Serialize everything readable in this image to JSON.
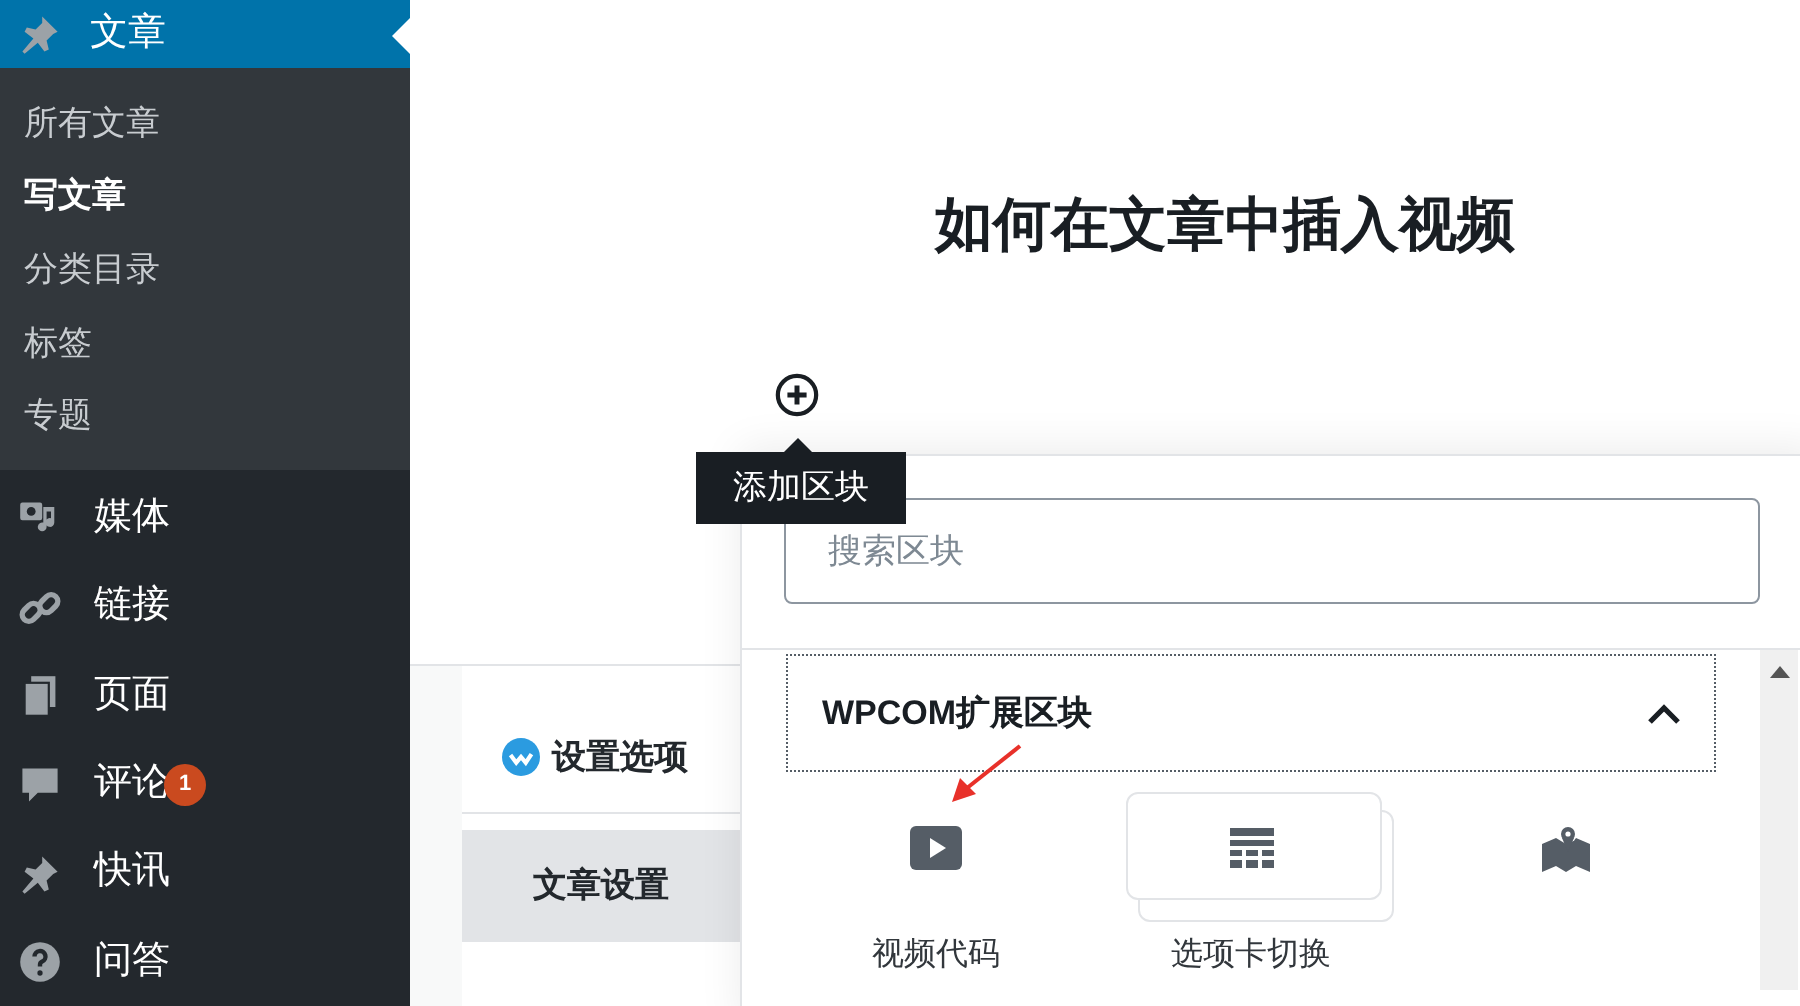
{
  "sidebar": {
    "current": {
      "label": "文章",
      "expanded": true
    },
    "submenu": [
      {
        "label": "所有文章",
        "selected": false
      },
      {
        "label": "写文章",
        "selected": true
      },
      {
        "label": "分类目录",
        "selected": false
      },
      {
        "label": "标签",
        "selected": false
      },
      {
        "label": "专题",
        "selected": false
      }
    ],
    "items": [
      {
        "kind": "media",
        "label": "媒体"
      },
      {
        "kind": "link",
        "label": "链接"
      },
      {
        "kind": "page",
        "label": "页面"
      },
      {
        "kind": "comment",
        "label": "评论",
        "badge": "1"
      },
      {
        "kind": "pin",
        "label": "快讯"
      },
      {
        "kind": "help",
        "label": "问答"
      }
    ]
  },
  "post_title": "如何在文章中插入视频",
  "add_block_tooltip": "添加区块",
  "inserter": {
    "search": {
      "placeholder": "搜索区块"
    },
    "category": {
      "label": "WPCOM扩展区块",
      "expanded": true
    },
    "blocks": [
      {
        "kind": "video",
        "label": "视频代码",
        "selected": false,
        "annotated": true
      },
      {
        "kind": "tabs",
        "label": "选项卡切换",
        "selected": true,
        "annotated": false
      },
      {
        "kind": "map",
        "selected": false,
        "annotated": false
      }
    ]
  },
  "settings_panel": {
    "title": "设置选项",
    "tabs": [
      {
        "label": "文章设置",
        "selected": true
      }
    ]
  }
}
